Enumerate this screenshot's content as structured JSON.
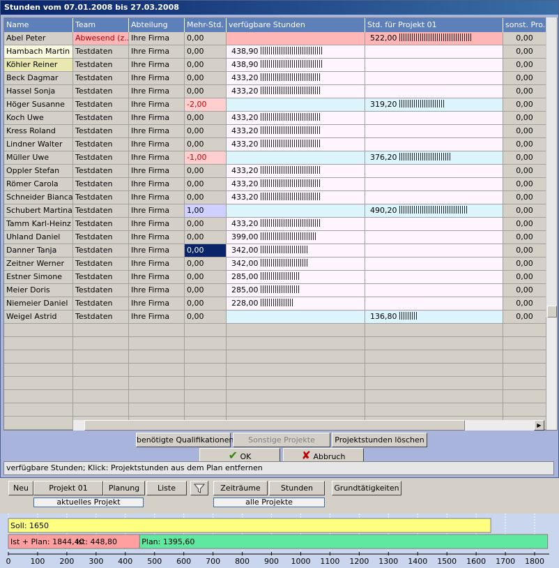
{
  "window": {
    "title": "Stunden vom 07.01.2008 bis 27.03.2008"
  },
  "grid": {
    "headers": [
      "Name",
      "Team",
      "Abteilung",
      "Mehr-Std.",
      "verfügbare Stunden",
      "Std. für Projekt 01",
      "sonst. Pro."
    ],
    "rows": [
      {
        "name": "Abel Peter",
        "team": "Abwesend (z....",
        "abteilung": "Ihre Firma",
        "mehr": "0,00",
        "verf": "",
        "verf_level": 0,
        "proj": "522,00",
        "proj_level": 522,
        "sonst": "0,00"
      },
      {
        "name": "Hambach Martin",
        "team": "Testdaten",
        "abteilung": "Ihre Firma",
        "mehr": "0,00",
        "verf": "438,90",
        "verf_level": 438.9,
        "proj": "",
        "proj_level": 0,
        "sonst": "0,00"
      },
      {
        "name": "Köhler Reiner",
        "team": "Testdaten",
        "abteilung": "Ihre Firma",
        "mehr": "0,00",
        "verf": "438,90",
        "verf_level": 438.9,
        "proj": "",
        "proj_level": 0,
        "sonst": "0,00"
      },
      {
        "name": "Beck Dagmar",
        "team": "Testdaten",
        "abteilung": "Ihre Firma",
        "mehr": "0,00",
        "verf": "433,20",
        "verf_level": 433.2,
        "proj": "",
        "proj_level": 0,
        "sonst": "0,00"
      },
      {
        "name": "Hassel Sonja",
        "team": "Testdaten",
        "abteilung": "Ihre Firma",
        "mehr": "0,00",
        "verf": "433,20",
        "verf_level": 433.2,
        "proj": "",
        "proj_level": 0,
        "sonst": "0,00"
      },
      {
        "name": "Höger Susanne",
        "team": "Testdaten",
        "abteilung": "Ihre Firma",
        "mehr": "-2,00",
        "verf": "",
        "verf_level": 0,
        "proj": "319,20",
        "proj_level": 319.2,
        "sonst": "0,00"
      },
      {
        "name": "Koch Uwe",
        "team": "Testdaten",
        "abteilung": "Ihre Firma",
        "mehr": "0,00",
        "verf": "433,20",
        "verf_level": 433.2,
        "proj": "",
        "proj_level": 0,
        "sonst": "0,00"
      },
      {
        "name": "Kress Roland",
        "team": "Testdaten",
        "abteilung": "Ihre Firma",
        "mehr": "0,00",
        "verf": "433,20",
        "verf_level": 433.2,
        "proj": "",
        "proj_level": 0,
        "sonst": "0,00"
      },
      {
        "name": "Lindner Walter",
        "team": "Testdaten",
        "abteilung": "Ihre Firma",
        "mehr": "0,00",
        "verf": "433,20",
        "verf_level": 433.2,
        "proj": "",
        "proj_level": 0,
        "sonst": "0,00"
      },
      {
        "name": "Müller Uwe",
        "team": "Testdaten",
        "abteilung": "Ihre Firma",
        "mehr": "-1,00",
        "verf": "",
        "verf_level": 0,
        "proj": "376,20",
        "proj_level": 376.2,
        "sonst": "0,00"
      },
      {
        "name": "Oppler Stefan",
        "team": "Testdaten",
        "abteilung": "Ihre Firma",
        "mehr": "0,00",
        "verf": "433,20",
        "verf_level": 433.2,
        "proj": "",
        "proj_level": 0,
        "sonst": "0,00"
      },
      {
        "name": "Römer Carola",
        "team": "Testdaten",
        "abteilung": "Ihre Firma",
        "mehr": "0,00",
        "verf": "433,20",
        "verf_level": 433.2,
        "proj": "",
        "proj_level": 0,
        "sonst": "0,00"
      },
      {
        "name": "Schneider Bianca",
        "team": "Testdaten",
        "abteilung": "Ihre Firma",
        "mehr": "0,00",
        "verf": "433,20",
        "verf_level": 433.2,
        "proj": "",
        "proj_level": 0,
        "sonst": "0,00"
      },
      {
        "name": "Schubert Martina",
        "team": "Testdaten",
        "abteilung": "Ihre Firma",
        "mehr": "1,00",
        "verf": "",
        "verf_level": 0,
        "proj": "490,20",
        "proj_level": 490.2,
        "sonst": "0,00"
      },
      {
        "name": "Tamm Karl-Heinz",
        "team": "Testdaten",
        "abteilung": "Ihre Firma",
        "mehr": "0,00",
        "verf": "433,20",
        "verf_level": 433.2,
        "proj": "",
        "proj_level": 0,
        "sonst": "0,00"
      },
      {
        "name": "Uhland Daniel",
        "team": "Testdaten",
        "abteilung": "Ihre Firma",
        "mehr": "0,00",
        "verf": "399,00",
        "verf_level": 399,
        "proj": "",
        "proj_level": 0,
        "sonst": "0,00"
      },
      {
        "name": "Danner Tanja",
        "team": "Testdaten",
        "abteilung": "Ihre Firma",
        "mehr": "0,00",
        "verf": "342,00",
        "verf_level": 342,
        "proj": "",
        "proj_level": 0,
        "sonst": "0,00"
      },
      {
        "name": "Zeitner Werner",
        "team": "Testdaten",
        "abteilung": "Ihre Firma",
        "mehr": "0,00",
        "verf": "342,00",
        "verf_level": 342,
        "proj": "",
        "proj_level": 0,
        "sonst": "0,00"
      },
      {
        "name": "Estner Simone",
        "team": "Testdaten",
        "abteilung": "Ihre Firma",
        "mehr": "0,00",
        "verf": "285,00",
        "verf_level": 285,
        "proj": "",
        "proj_level": 0,
        "sonst": "0,00"
      },
      {
        "name": "Meier Doris",
        "team": "Testdaten",
        "abteilung": "Ihre Firma",
        "mehr": "0,00",
        "verf": "285,00",
        "verf_level": 285,
        "proj": "",
        "proj_level": 0,
        "sonst": "0,00"
      },
      {
        "name": "Niemeier Daniel",
        "team": "Testdaten",
        "abteilung": "Ihre Firma",
        "mehr": "0,00",
        "verf": "228,00",
        "verf_level": 228,
        "proj": "",
        "proj_level": 0,
        "sonst": "0,00"
      },
      {
        "name": "Weigel Astrid",
        "team": "Testdaten",
        "abteilung": "Ihre Firma",
        "mehr": "0,00",
        "verf": "",
        "verf_level": 0,
        "proj": "136,80",
        "proj_level": 136.8,
        "sonst": "0,00"
      }
    ]
  },
  "actions": {
    "qualifikationen": "benötigte Qualifikationen",
    "sonstige": "Sonstige Projekte",
    "loeschen": "Projektstunden löschen",
    "ok": "OK",
    "abbruch": "Abbruch"
  },
  "status": "verfügbare Stunden; Klick: Projektstunden aus dem Plan entfernen",
  "toolbar": {
    "neu": "Neu",
    "projekt": "Projekt 01",
    "planung": "Planung",
    "liste": "Liste",
    "zeitraeume": "Zeiträume",
    "stunden": "Stunden",
    "grund": "Grundtätigkeiten",
    "tag_aktuell": "aktuelles Projekt",
    "tag_alle": "alle Projekte"
  },
  "colors": {
    "header": "#5d7fba",
    "selection": "#0a246a",
    "soll": "#ffff80",
    "ist": "#ff9f9f",
    "plan": "#60e8a0"
  },
  "chart_data": {
    "type": "bar",
    "bars": [
      {
        "label": "Soll: 1650",
        "start": 0,
        "end": 1650
      },
      {
        "label": "Ist + Plan: 1844,40",
        "start": 0,
        "end": 1844.4
      },
      {
        "label": "Ist: 448,80",
        "start": 0,
        "end": 448.8
      },
      {
        "label": "Plan: 1395,60",
        "start": 448.8,
        "end": 1844.4
      }
    ],
    "xlim": [
      0,
      1850
    ],
    "xticks": [
      "0",
      "100",
      "200",
      "300",
      "400",
      "500",
      "600",
      "700",
      "800",
      "900",
      "1000",
      "1100",
      "1200",
      "1300",
      "1400",
      "1500",
      "1600",
      "1700",
      "1800"
    ]
  }
}
